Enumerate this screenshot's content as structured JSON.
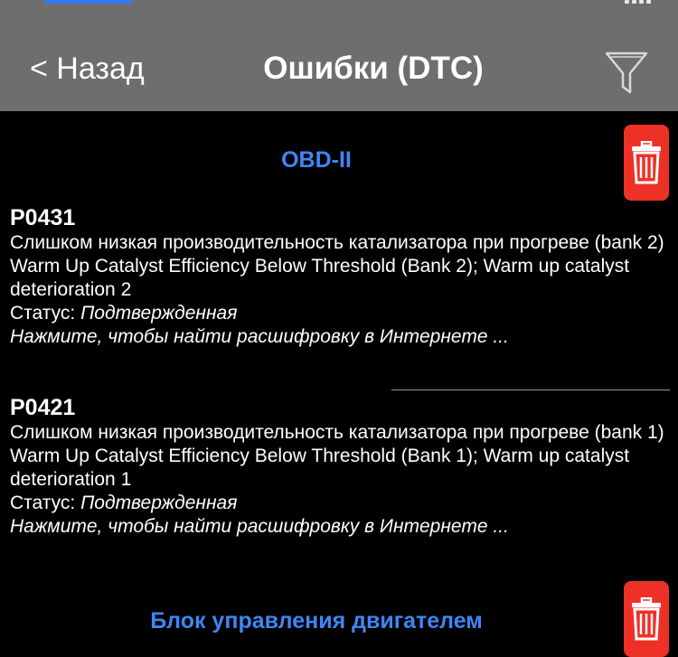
{
  "navbar": {
    "back_label": "< Назад",
    "title": "Ошибки (DTC)"
  },
  "sections": [
    {
      "header": "OBD-II",
      "errors": [
        {
          "code": "P0431",
          "description_ru": "Слишком низкая производительность катализатора при прогреве (bank 2)",
          "description_en": "Warm Up Catalyst Efficiency Below Threshold (Bank 2); Warm up catalyst deterioration 2",
          "status_label": "Статус: ",
          "status_value": "Подтвержденная",
          "lookup": "Нажмите, чтобы найти расшифровку в Интернете ..."
        },
        {
          "code": "P0421",
          "description_ru": "Слишком низкая производительность катализатора при прогреве (bank 1)",
          "description_en": "Warm Up Catalyst Efficiency Below Threshold (Bank 1); Warm up catalyst deterioration 1",
          "status_label": "Статус: ",
          "status_value": "Подтвержденная",
          "lookup": "Нажмите, чтобы найти расшифровку в Интернете ..."
        }
      ]
    },
    {
      "header": "Блок управления двигателем",
      "errors": []
    }
  ],
  "icons": {
    "back": "chevron-left-icon",
    "filter": "filter-icon",
    "delete": "trash-icon"
  },
  "colors": {
    "navbar_bg": "#6e6e6e",
    "section_header": "#3f86f5",
    "delete_bg": "#ee3126",
    "background": "#000000"
  }
}
